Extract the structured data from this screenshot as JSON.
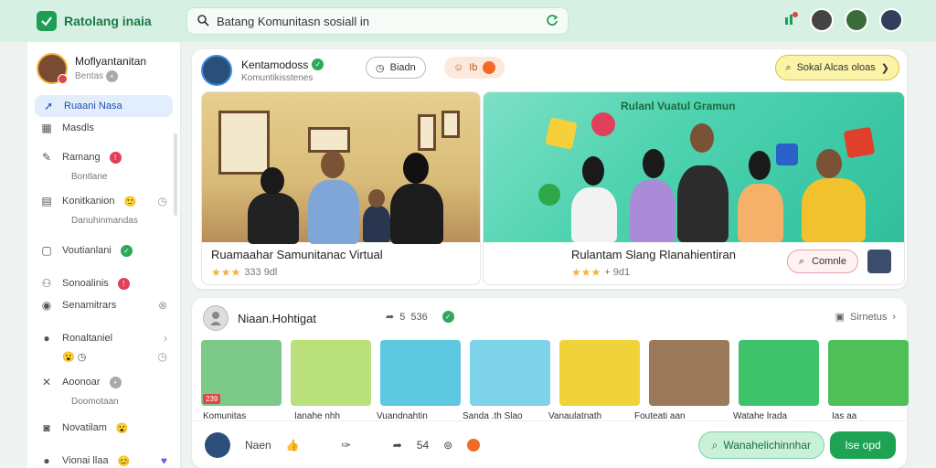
{
  "app": {
    "name": "Ratolang inaia"
  },
  "search": {
    "value": "Batang Komunitasn sosiall in"
  },
  "sidebar": {
    "profile": {
      "name": "Moflyantanitan",
      "status": "Bentas"
    },
    "items": [
      {
        "label": "Ruaani Nasa",
        "sub": "Masdls"
      },
      {
        "label": "Ramang",
        "sub": "Bontlane"
      },
      {
        "label": "Konitkanion",
        "sub": "Danuhinmandas"
      },
      {
        "label": "Voutianlani"
      },
      {
        "label": "Sonoalinis",
        "sub": "Senamitrars"
      },
      {
        "label": "Ronaltaniel"
      },
      {
        "label": "Aoonoar",
        "sub": "Doomotaan"
      },
      {
        "label": "Novatilam"
      },
      {
        "label": "Vionai llaa"
      }
    ]
  },
  "post": {
    "author": "Kentamodoss",
    "subtitle": "Komuntikisstenes",
    "view_chip": "Biadn",
    "live_chip": "Ib",
    "cta": "Sokal Alcas oloas",
    "card1": {
      "caption": "Ruamaahar Samunitanac Virtual",
      "meta": "333 9dl"
    },
    "card2": {
      "caption": "Rulantam Slang Rlanahientiran",
      "meta": "+ 9d1",
      "button": "Comnle",
      "banner": "Rulanl Vuatul Gramun"
    }
  },
  "gallery": {
    "title": "Niaan.Hohtigat",
    "share_count": "536",
    "right_label": "Sirnetus",
    "thumbs": [
      {
        "label": "Komunitas",
        "badge": "239"
      },
      {
        "label": "Ianahe nhh"
      },
      {
        "label": "Vuandnahtin"
      },
      {
        "label": "Sanda .th Slao"
      },
      {
        "label": "Vanaulatnath"
      },
      {
        "label": "Fouteati aan"
      },
      {
        "label": "Watahe lrada"
      },
      {
        "label": "Ias aa"
      }
    ],
    "action_name": "Naen",
    "action_count": "54",
    "btn_secondary": "Wanahelichinnhar",
    "btn_primary": "Ise opd"
  },
  "colors": {
    "brand": "#1e9e55",
    "accent": "#1e4fb3"
  }
}
